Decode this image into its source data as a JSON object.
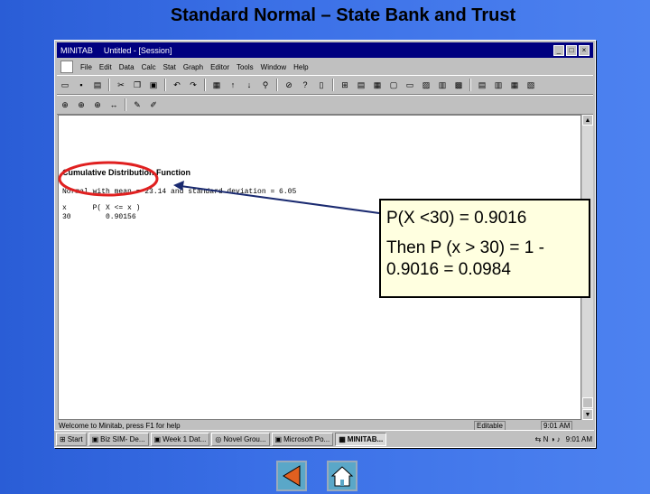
{
  "slide": {
    "title": "Standard Normal – State Bank and Trust",
    "callout": {
      "line1": "P(X <30) = 0.9016",
      "line2": "Then P (x > 30) = 1 - 0.9016 = 0.0984"
    }
  },
  "window": {
    "app_name": "MINITAB",
    "title": "Untitled - [Session]",
    "menu": [
      "File",
      "Edit",
      "Data",
      "Calc",
      "Stat",
      "Graph",
      "Editor",
      "Tools",
      "Window",
      "Help"
    ],
    "session": {
      "heading": "Cumulative Distribution Function",
      "desc": "Normal with mean = 23.14 and standard deviation = 6.05",
      "col_header": "x      P( X <= x )",
      "row": "30        0.90156"
    },
    "status_message": "Welcome to Minitab, press F1 for help",
    "status_mode": "Editable",
    "status_time": "9:01 AM"
  },
  "taskbar": {
    "start": "Start",
    "tasks": [
      "Biz SIM- De...",
      "Week 1 Dat...",
      "Novel Grou...",
      "Microsoft Po...",
      "MINITAB..."
    ],
    "clock": "9:01 AM"
  },
  "colors": {
    "slide_bg": "#3a6fe6",
    "title_bar": "#000080",
    "callout_bg": "#ffffe0",
    "circle": "#e02020"
  },
  "icons": [
    "back-arrow-icon",
    "home-icon"
  ]
}
